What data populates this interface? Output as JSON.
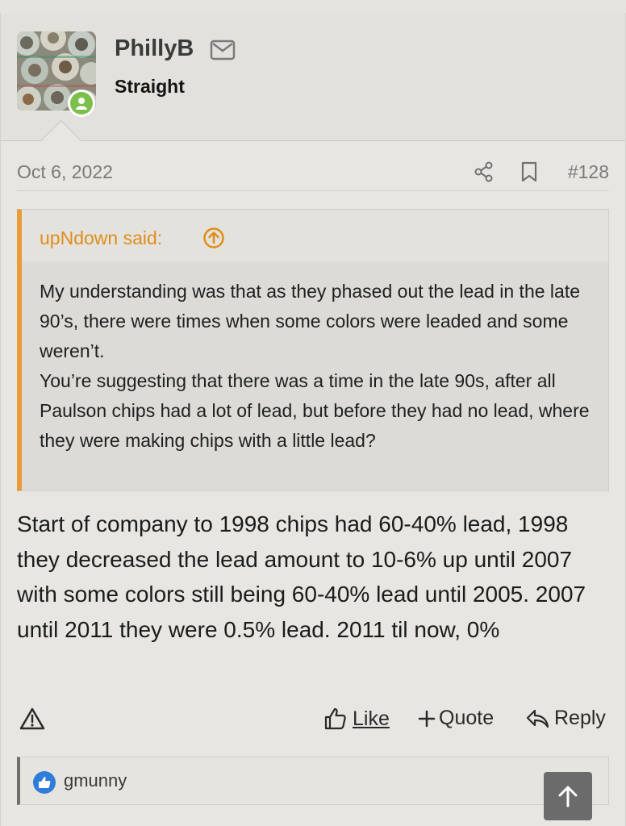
{
  "post": {
    "user": {
      "name": "PhillyB",
      "title": "Straight"
    },
    "meta": {
      "date": "Oct 6, 2022",
      "post_number": "#128"
    },
    "quote": {
      "author": "upNdown said:",
      "lines": [
        "My understanding was that as they phased out the lead in the late 90’s, there were times when some colors were leaded and some weren’t.",
        "You’re suggesting that there was a time in the late 90s, after all Paulson chips had a lot of lead, but before they had no lead, where they were making chips with a little lead?"
      ]
    },
    "body": "Start of company to 1998 chips had 60-40% lead, 1998 they decreased the lead amount to 10-6% up until 2007 with some colors still being 60-40% lead until 2005. 2007 until 2011 they were 0.5% lead. 2011 til now, 0%",
    "actions": {
      "like": "Like",
      "quote": "Quote",
      "reply": "Reply"
    },
    "reactions": {
      "users": "gmunny"
    }
  },
  "icons": {
    "online": "online-user-icon",
    "mail": "mail-icon",
    "share": "share-icon",
    "bookmark": "bookmark-icon",
    "quote_jump": "arrow-up-circle-icon",
    "report": "warning-icon",
    "like": "thumbs-up-icon",
    "quote_plus": "plus-icon",
    "reply": "reply-icon",
    "scroll_top": "arrow-up-icon"
  },
  "colors": {
    "page_bg": "#e7e6e1",
    "quote_accent": "#e89c3c",
    "online_green": "#7cbf4b",
    "reaction_blue": "#2f7dd9"
  }
}
